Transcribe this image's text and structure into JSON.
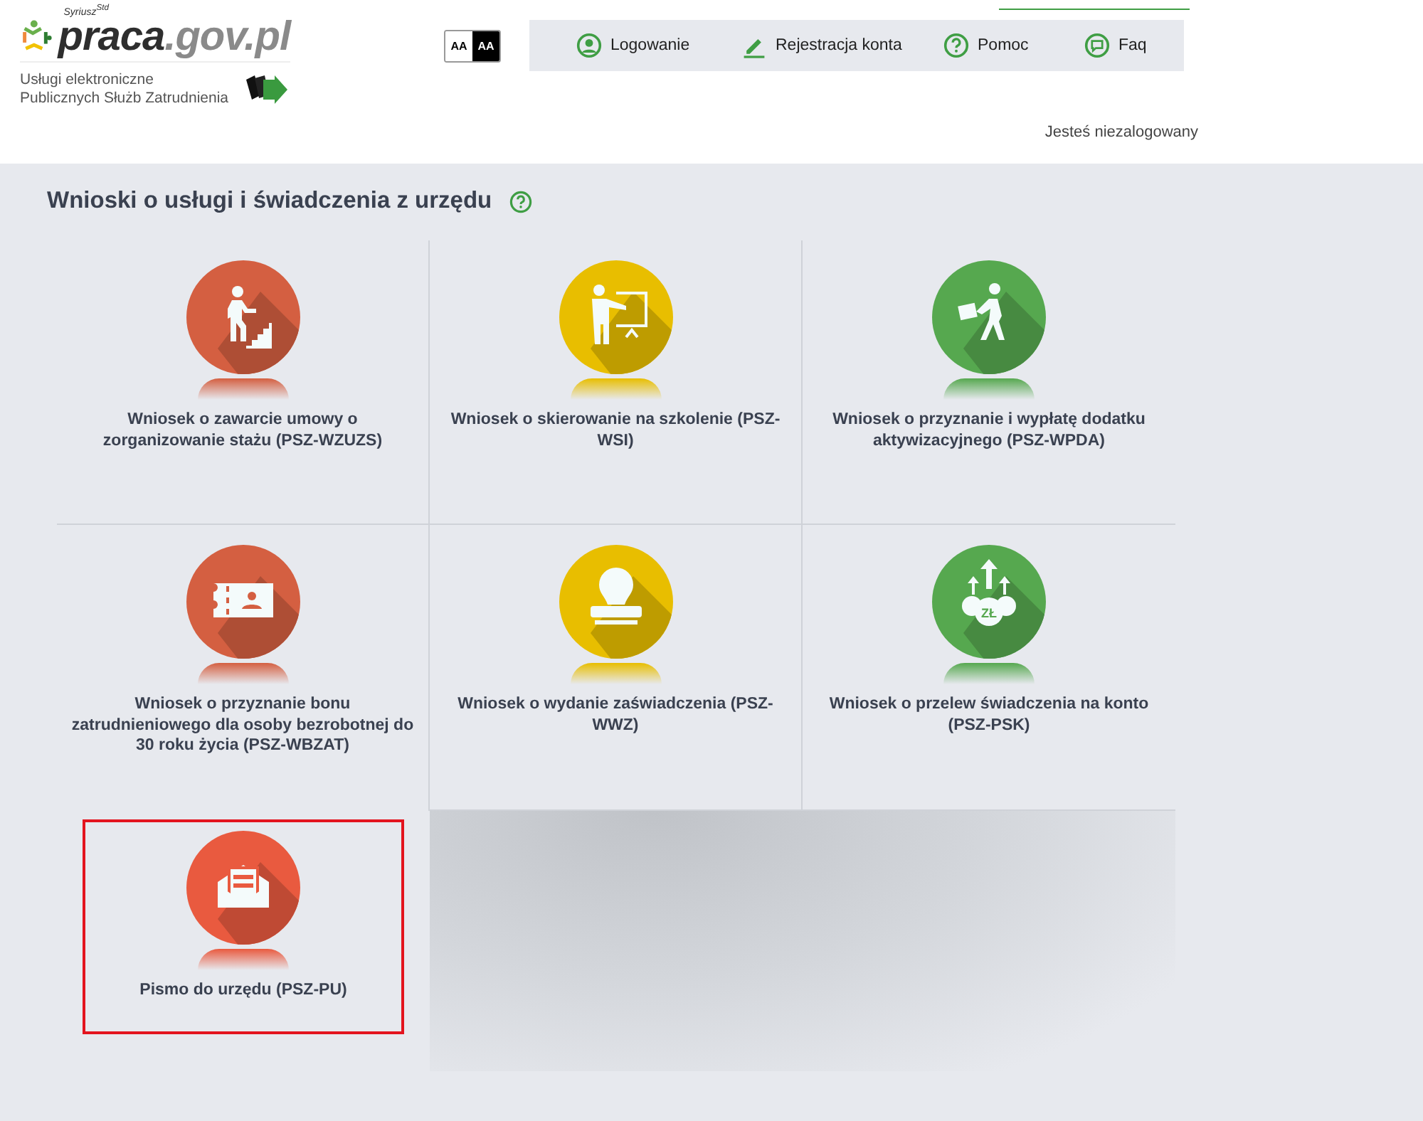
{
  "logo": {
    "supertext": "Syriusz$^{Std}$",
    "name": "praca",
    "domain": ".gov.pl",
    "subtitle_lines": [
      "Usługi elektroniczne",
      "Publicznych Służb Zatrudnienia"
    ]
  },
  "contrast_buttons": [
    {
      "label": "AA",
      "kind": "normal"
    },
    {
      "label": "AA",
      "kind": "high"
    }
  ],
  "nav": [
    {
      "label": "Logowanie",
      "kind": "user"
    },
    {
      "label": "Rejestracja konta",
      "kind": "pencil"
    },
    {
      "label": "Pomoc",
      "kind": "question"
    },
    {
      "label": "Faq",
      "kind": "chat"
    }
  ],
  "login_status": "Jesteś niezalogowany",
  "page_title": "Wnioski o usługi i świadczenia z urzędu",
  "tiles": [
    {
      "title": "Wniosek o zawarcie umowy o zorganizowanie stażu (PSZ-WZUZS)",
      "kind": "stairs",
      "color": "#d45f41",
      "highlighted": false
    },
    {
      "title": "Wniosek o skierowanie na szkolenie (PSZ-WSI)",
      "kind": "presentation",
      "color": "#e8be00",
      "highlighted": false
    },
    {
      "title": "Wniosek o przyznanie i wypłatę dodatku aktywizacyjnego (PSZ-WPDA)",
      "kind": "walker",
      "color": "#56a84f",
      "highlighted": false
    },
    {
      "title": "Wniosek o przyznanie bonu zatrudnieniowego dla osoby bezrobotnej do 30 roku życia (PSZ-WBZAT)",
      "kind": "voucher",
      "color": "#d45f41",
      "highlighted": false
    },
    {
      "title": "Wniosek o wydanie zaświadczenia (PSZ-WWZ)",
      "kind": "stamp",
      "color": "#e8be00",
      "highlighted": false
    },
    {
      "title": "Wniosek o przelew świadczenia na konto (PSZ-PSK)",
      "kind": "money",
      "icon_text": "ZŁ",
      "color": "#56a84f",
      "highlighted": false
    },
    {
      "title": "Pismo do urzędu (PSZ-PU)",
      "kind": "envelope",
      "color": "#e95a3f",
      "highlighted": true
    }
  ]
}
